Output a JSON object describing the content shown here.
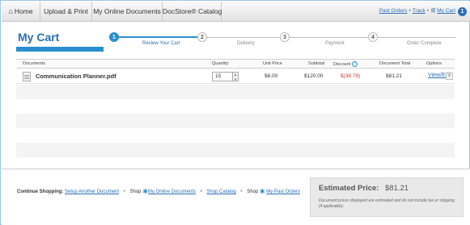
{
  "nav": {
    "tabs": [
      {
        "label": "Home",
        "icon": "home-icon"
      },
      {
        "label": "Upload & Print"
      },
      {
        "label": "My Online Documents"
      },
      {
        "label": "DocStore® Catalog"
      }
    ],
    "links": {
      "past_orders": "Past Orders",
      "track": "Track",
      "my_cart": "My Cart",
      "cart_count": "1"
    }
  },
  "page": {
    "title": "My Cart"
  },
  "steps": [
    {
      "num": "1",
      "label": "Review Your Cart",
      "active": true
    },
    {
      "num": "2",
      "label": "Delivery"
    },
    {
      "num": "3",
      "label": "Payment"
    },
    {
      "num": "4",
      "label": "Order Complete"
    }
  ],
  "table": {
    "headers": {
      "documents": "Documents",
      "quantity": "Quantity",
      "unit_price": "Unit Price",
      "subtotal": "Subtotal",
      "discount": "Discount",
      "document_total": "Document Total",
      "options": "Options"
    },
    "rows": [
      {
        "name": "Communication Planner.pdf",
        "quantity": "15",
        "unit_price": "$8.00",
        "subtotal": "$120.00",
        "discount": "$(38.79)",
        "total": "$81.21",
        "view_edit": "View/Edit",
        "remove": "x"
      }
    ]
  },
  "footer": {
    "continue_label": "Continue Shopping:",
    "setup_link": "Setup Another Document",
    "shop_prefix": "Shop",
    "online_docs_link": "My Online Documents",
    "catalog_link": "Shop Catalog",
    "past_orders_link": "My Past Orders",
    "estimated_label": "Estimated Price:",
    "estimated_value": "$81.21",
    "note": "Document prices displayed are estimated and do not include tax or shipping (if applicable)."
  },
  "colors": {
    "accent": "#2a8fcf",
    "link": "#2a6fb5",
    "discount": "#c0392b"
  }
}
